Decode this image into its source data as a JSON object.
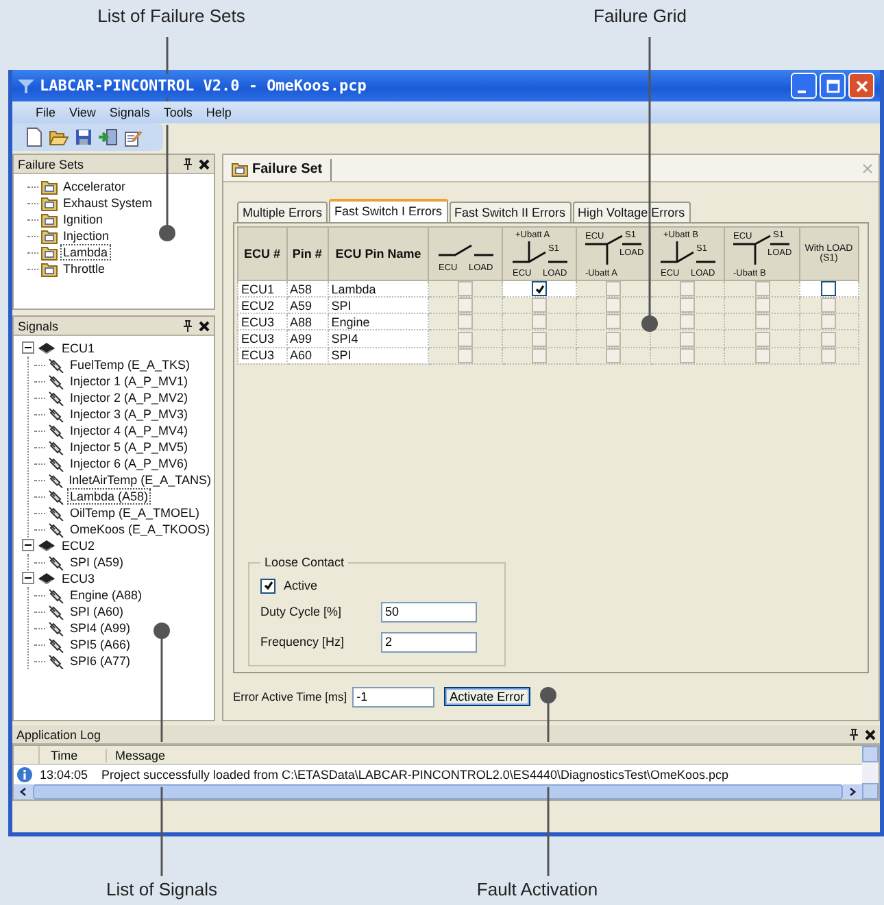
{
  "annotations": [
    {
      "label": "List of Failure Sets"
    },
    {
      "label": "Failure Grid"
    },
    {
      "label": "List of Signals"
    },
    {
      "label": "Fault Activation"
    }
  ],
  "window": {
    "title": "LABCAR-PINCONTROL V2.0 - OmeKoos.pcp"
  },
  "menu": [
    "File",
    "View",
    "Signals",
    "Tools",
    "Help"
  ],
  "failure_sets": {
    "title": "Failure Sets",
    "items": [
      {
        "label": "Accelerator",
        "selected": false
      },
      {
        "label": "Exhaust System",
        "selected": false
      },
      {
        "label": "Ignition",
        "selected": false
      },
      {
        "label": "Injection",
        "selected": false
      },
      {
        "label": "Lambda",
        "selected": true
      },
      {
        "label": "Throttle",
        "selected": false
      }
    ]
  },
  "signals": {
    "title": "Signals",
    "tree": [
      {
        "label": "ECU1",
        "expanded": true,
        "children": [
          {
            "label": "FuelTemp (E_A_TKS)",
            "selected": false
          },
          {
            "label": "Injector 1 (A_P_MV1)",
            "selected": false
          },
          {
            "label": "Injector 2 (A_P_MV2)",
            "selected": false
          },
          {
            "label": "Injector 3 (A_P_MV3)",
            "selected": false
          },
          {
            "label": "Injector 4 (A_P_MV4)",
            "selected": false
          },
          {
            "label": "Injector 5 (A_P_MV5)",
            "selected": false
          },
          {
            "label": "Injector 6 (A_P_MV6)",
            "selected": false
          },
          {
            "label": "InletAirTemp (E_A_TANS)",
            "selected": false
          },
          {
            "label": "Lambda (A58)",
            "selected": true
          },
          {
            "label": "OilTemp (E_A_TMOEL)",
            "selected": false
          },
          {
            "label": "OmeKoos (E_A_TKOOS)",
            "selected": false
          }
        ]
      },
      {
        "label": "ECU2",
        "expanded": true,
        "children": [
          {
            "label": "SPI (A59)",
            "selected": false
          }
        ]
      },
      {
        "label": "ECU3",
        "expanded": true,
        "children": [
          {
            "label": "Engine (A88)",
            "selected": false
          },
          {
            "label": "SPI (A60)",
            "selected": false
          },
          {
            "label": "SPI4 (A99)",
            "selected": false
          },
          {
            "label": "SPI5 (A66)",
            "selected": false
          },
          {
            "label": "SPI6 (A77)",
            "selected": false
          }
        ]
      }
    ]
  },
  "document_tab": {
    "title": "Failure Set"
  },
  "tabs": [
    {
      "label": "Multiple Errors",
      "selected": false
    },
    {
      "label": "Fast Switch I Errors",
      "selected": true
    },
    {
      "label": "Fast Switch II Errors",
      "selected": false
    },
    {
      "label": "High Voltage Errors",
      "selected": false
    }
  ],
  "grid": {
    "columns": [
      {
        "kind": "text",
        "labels": [
          "ECU #"
        ]
      },
      {
        "kind": "text",
        "labels": [
          "Pin #"
        ]
      },
      {
        "kind": "text",
        "labels": [
          "ECU Pin Name"
        ]
      },
      {
        "kind": "switch",
        "labels": [
          "ECU",
          "LOAD"
        ]
      },
      {
        "kind": "ubatt_high",
        "labels": [
          "+Ubatt A",
          "S1",
          "ECU",
          "LOAD"
        ]
      },
      {
        "kind": "ubatt_low",
        "labels": [
          "ECU",
          "S1",
          "LOAD",
          "-Ubatt A"
        ]
      },
      {
        "kind": "ubatt_high",
        "labels": [
          "+Ubatt B",
          "S1",
          "ECU",
          "LOAD"
        ]
      },
      {
        "kind": "ubatt_low",
        "labels": [
          "ECU",
          "S1",
          "LOAD",
          "-Ubatt B"
        ]
      },
      {
        "kind": "note",
        "labels": [
          "With LOAD (S1)"
        ]
      }
    ],
    "rows": [
      {
        "cells": [
          "ECU1",
          "A58",
          "Lambda"
        ],
        "checks": [
          {
            "checked": false,
            "disabled": true
          },
          {
            "checked": true,
            "disabled": false
          },
          {
            "checked": false,
            "disabled": true
          },
          {
            "checked": false,
            "disabled": true
          },
          {
            "checked": false,
            "disabled": true
          },
          {
            "checked": false,
            "disabled": false
          }
        ]
      },
      {
        "cells": [
          "ECU2",
          "A59",
          "SPI"
        ],
        "checks": [
          {
            "checked": false,
            "disabled": true
          },
          {
            "checked": false,
            "disabled": true
          },
          {
            "checked": false,
            "disabled": true
          },
          {
            "checked": false,
            "disabled": true
          },
          {
            "checked": false,
            "disabled": true
          },
          {
            "checked": false,
            "disabled": true
          }
        ]
      },
      {
        "cells": [
          "ECU3",
          "A88",
          "Engine"
        ],
        "checks": [
          {
            "checked": false,
            "disabled": true
          },
          {
            "checked": false,
            "disabled": true
          },
          {
            "checked": false,
            "disabled": true
          },
          {
            "checked": false,
            "disabled": true
          },
          {
            "checked": false,
            "disabled": true
          },
          {
            "checked": false,
            "disabled": true
          }
        ]
      },
      {
        "cells": [
          "ECU3",
          "A99",
          "SPI4"
        ],
        "checks": [
          {
            "checked": false,
            "disabled": true
          },
          {
            "checked": false,
            "disabled": true
          },
          {
            "checked": false,
            "disabled": true
          },
          {
            "checked": false,
            "disabled": true
          },
          {
            "checked": false,
            "disabled": true
          },
          {
            "checked": false,
            "disabled": true
          }
        ]
      },
      {
        "cells": [
          "ECU3",
          "A60",
          "SPI"
        ],
        "checks": [
          {
            "checked": false,
            "disabled": true
          },
          {
            "checked": false,
            "disabled": true
          },
          {
            "checked": false,
            "disabled": true
          },
          {
            "checked": false,
            "disabled": true
          },
          {
            "checked": false,
            "disabled": true
          },
          {
            "checked": false,
            "disabled": true
          }
        ]
      }
    ]
  },
  "loose_contact": {
    "title": "Loose Contact",
    "active": {
      "label": "Active",
      "checked": true
    },
    "fields": [
      {
        "label": "Duty Cycle [%]",
        "value": "50"
      },
      {
        "label": "Frequency [Hz]",
        "value": "2"
      }
    ]
  },
  "error_time": {
    "label": "Error Active Time [ms]",
    "value": "-1"
  },
  "activate_button": {
    "label": "Activate Error"
  },
  "log": {
    "title": "Application Log",
    "columns": [
      "Time",
      "Message"
    ],
    "rows": [
      {
        "time": "13:04:05",
        "message": "Project successfully loaded from C:\\ETASData\\LABCAR-PINCONTROL2.0\\ES4440\\DiagnosticsTest\\OmeKoos.pcp"
      }
    ]
  }
}
